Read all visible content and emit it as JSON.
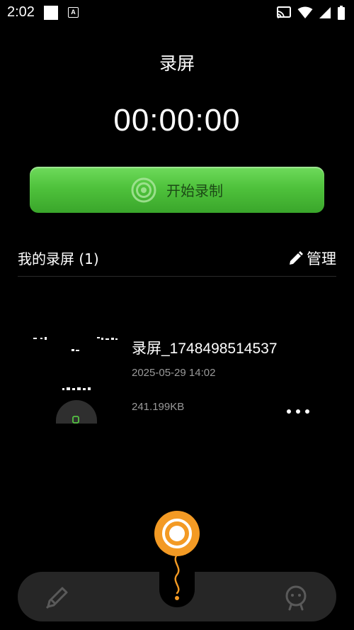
{
  "status_bar": {
    "time": "2:02",
    "icons": [
      "white-square-icon",
      "a-notification-icon",
      "cast-icon",
      "wifi-icon",
      "signal-icon",
      "battery-icon"
    ]
  },
  "page": {
    "title": "录屏",
    "timer": "00:00:00"
  },
  "record_button": {
    "label": "开始录制",
    "color": "#4fc23c"
  },
  "section": {
    "title": "我的录屏 (1)",
    "manage_label": "管理"
  },
  "recordings": [
    {
      "name_prefix": "录屏",
      "name_suffix": "_1748498514537",
      "date": "2025-05-29 14:02",
      "size": "241.199KB"
    }
  ],
  "bottom_nav": {
    "left_icon": "edit-pen-icon",
    "center_icon": "record-icon",
    "right_icon": "profile-icon",
    "center_color": "#f39a24"
  }
}
